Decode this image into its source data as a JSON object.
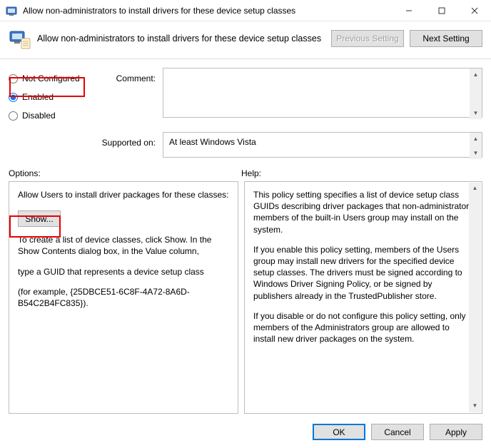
{
  "window": {
    "title": "Allow non-administrators to install drivers for these device setup classes"
  },
  "header": {
    "title": "Allow non-administrators to install drivers for these device setup classes",
    "prev": "Previous Setting",
    "next": "Next Setting"
  },
  "radios": {
    "not_configured": "Not Configured",
    "enabled": "Enabled",
    "disabled": "Disabled",
    "selected": "enabled"
  },
  "labels": {
    "comment": "Comment:",
    "supported": "Supported on:",
    "options": "Options:",
    "help": "Help:"
  },
  "supported_text": "At least Windows Vista",
  "options_panel": {
    "line1": "Allow Users to install driver packages for these classes:",
    "show_btn": "Show...",
    "line2": "To create a list of device classes, click Show. In the Show Contents dialog box, in the Value column,",
    "line3": "type a GUID that represents a device setup class",
    "line4": "(for example, {25DBCE51-6C8F-4A72-8A6D-B54C2B4FC835})."
  },
  "help_panel": {
    "p1": "This policy setting specifies a list of device setup class GUIDs describing driver packages that non-administrator members of the built-in Users group may install on the system.",
    "p2": "If you enable this policy setting, members of the Users group may install new drivers for the specified device setup classes. The drivers must be signed according to Windows Driver Signing Policy, or be signed by publishers already in the TrustedPublisher store.",
    "p3": "If you disable or do not configure this policy setting, only members of the Administrators group are allowed to install new driver packages on the system."
  },
  "footer": {
    "ok": "OK",
    "cancel": "Cancel",
    "apply": "Apply"
  }
}
